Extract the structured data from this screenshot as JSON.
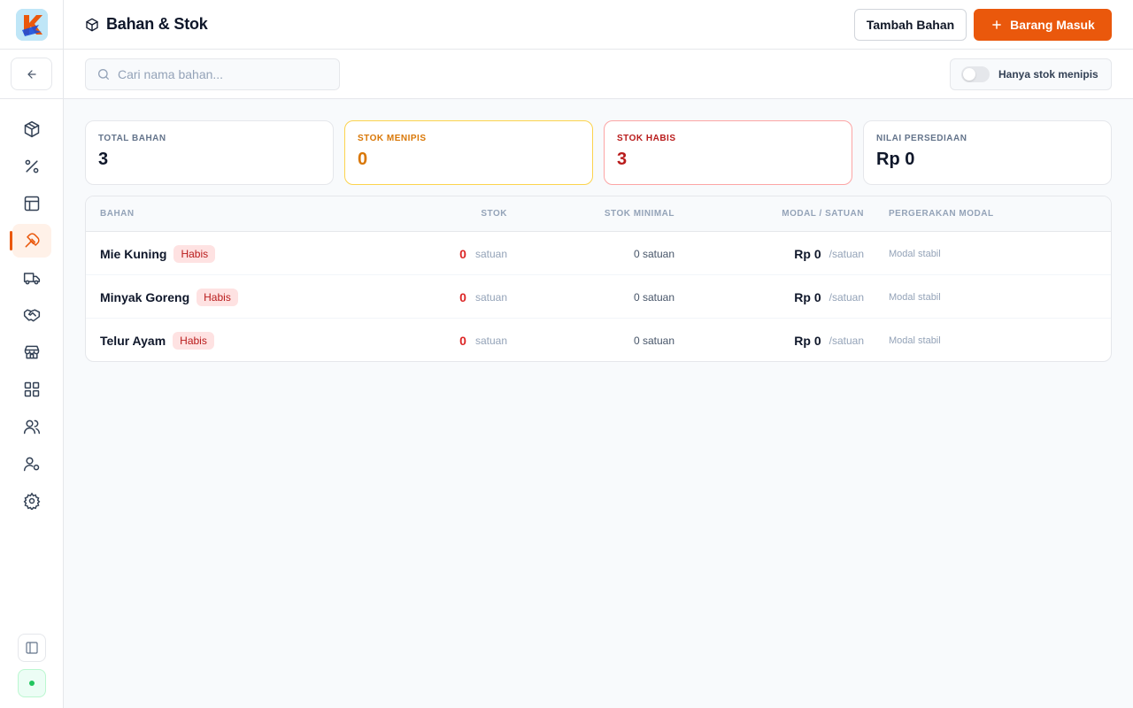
{
  "header": {
    "title": "Bahan & Stok",
    "add_material_label": "Tambah Bahan",
    "incoming_goods_label": "Barang Masuk"
  },
  "toolbar": {
    "search_placeholder": "Cari nama bahan...",
    "search_value": "",
    "low_stock_toggle_label": "Hanya stok menipis",
    "low_stock_toggle_on": false
  },
  "stats": [
    {
      "label": "TOTAL BAHAN",
      "value": "3",
      "tone": "neutral"
    },
    {
      "label": "STOK MENIPIS",
      "value": "0",
      "tone": "warning"
    },
    {
      "label": "STOK HABIS",
      "value": "3",
      "tone": "danger"
    },
    {
      "label": "NILAI PERSEDIAAN",
      "value": "Rp 0",
      "tone": "neutral"
    }
  ],
  "table": {
    "columns": [
      "BAHAN",
      "STOK",
      "STOK MINIMAL",
      "MODAL / SATUAN",
      "PERGERAKAN MODAL"
    ],
    "rows": [
      {
        "name": "Mie Kuning",
        "badge": "Habis",
        "stock": "0",
        "stock_unit": "satuan",
        "min_stock": "0 satuan",
        "price": "Rp 0",
        "per": "/satuan",
        "movement": "Modal stabil"
      },
      {
        "name": "Minyak Goreng",
        "badge": "Habis",
        "stock": "0",
        "stock_unit": "satuan",
        "min_stock": "0 satuan",
        "price": "Rp 0",
        "per": "/satuan",
        "movement": "Modal stabil"
      },
      {
        "name": "Telur Ayam",
        "badge": "Habis",
        "stock": "0",
        "stock_unit": "satuan",
        "min_stock": "0 satuan",
        "price": "Rp 0",
        "per": "/satuan",
        "movement": "Modal stabil"
      }
    ]
  },
  "sidebar": {
    "items": [
      {
        "icon": "package-icon",
        "active": false
      },
      {
        "icon": "percent-icon",
        "active": false
      },
      {
        "icon": "layout-icon",
        "active": false
      },
      {
        "icon": "ingredients-icon",
        "active": true
      },
      {
        "icon": "truck-icon",
        "active": false
      },
      {
        "icon": "handshake-icon",
        "active": false
      },
      {
        "icon": "store-icon",
        "active": false
      },
      {
        "icon": "grid-icon",
        "active": false
      },
      {
        "icon": "users-icon",
        "active": false
      },
      {
        "icon": "user-cog-icon",
        "active": false
      },
      {
        "icon": "gear-icon",
        "active": false
      }
    ]
  },
  "colors": {
    "accent": "#ea580c",
    "warning": "#d97706",
    "danger": "#dc2626",
    "border": "#e5e7eb"
  }
}
